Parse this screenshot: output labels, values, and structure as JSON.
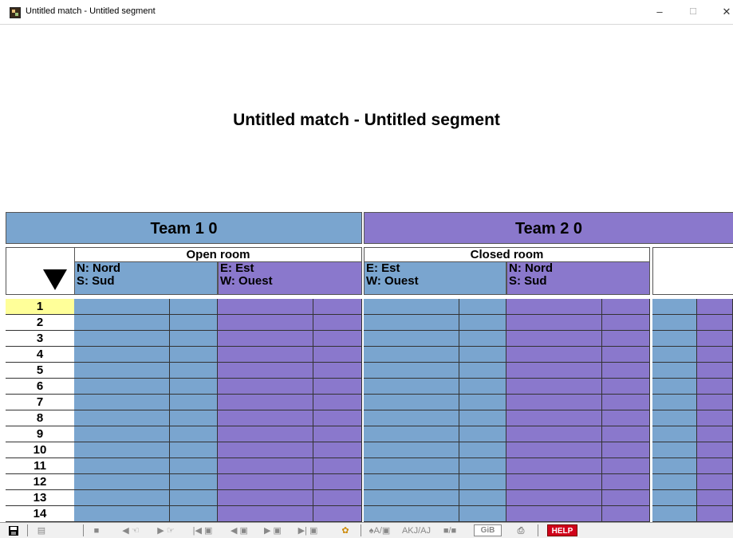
{
  "window": {
    "title": "Untitled match - Untitled segment",
    "minimize": "–",
    "maximize": "☐",
    "close": "✕"
  },
  "heading": "Untitled match - Untitled segment",
  "teams": [
    {
      "label": "Team 1 0",
      "color": "#7aa5cf"
    },
    {
      "label": "Team 2 0",
      "color": "#8a78cc"
    }
  ],
  "rooms": {
    "open": {
      "title": "Open room",
      "ns": "N: Nord\nS: Sud",
      "ew": "E: Est\nW: Ouest",
      "ns_lines": [
        "N: Nord",
        "S: Sud"
      ],
      "ew_lines": [
        "E: Est",
        "W: Ouest"
      ]
    },
    "closed": {
      "title": "Closed room",
      "ew_lines": [
        "E: Est",
        "W: Ouest"
      ],
      "ns_lines": [
        "N: Nord",
        "S: Sud"
      ]
    }
  },
  "boards": [
    "1",
    "2",
    "3",
    "4",
    "5",
    "6",
    "7",
    "8",
    "9",
    "10",
    "11",
    "12",
    "13",
    "14"
  ],
  "active_board": "1",
  "toolbar": {
    "gib": "GiB",
    "help": "HELP",
    "icons": [
      "save-icon",
      "settings-icon",
      "stop-icon",
      "prev-hand-icon",
      "next-hand-icon",
      "first-board-icon",
      "prev-board-icon",
      "next-board-icon",
      "last-board-icon",
      "bid-icon",
      "notation-icon",
      "card-format-icon",
      "display-icon",
      "gib-icon",
      "print-icon",
      "help-icon"
    ]
  },
  "colors": {
    "blue": "#7aa5cf",
    "purple": "#8a78cc",
    "active": "#ffff99"
  }
}
